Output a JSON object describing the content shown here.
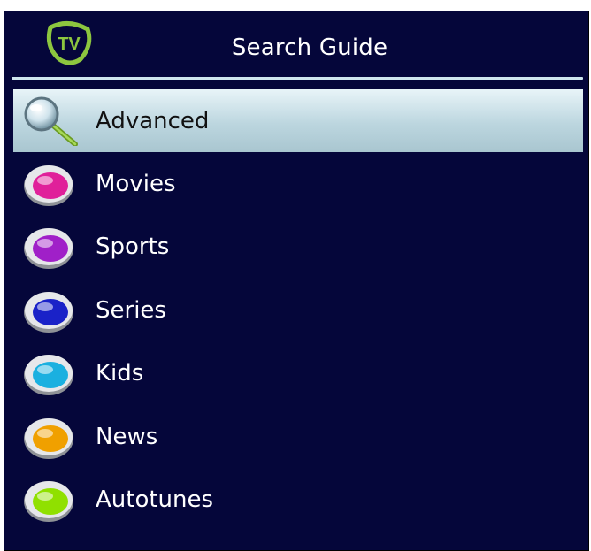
{
  "header": {
    "title": "Search Guide",
    "logo_text": "TV",
    "logo_icon": "tv-logo-icon"
  },
  "menu": {
    "items": [
      {
        "label": "Advanced",
        "icon": "magnifier-icon",
        "selected": true
      },
      {
        "label": "Movies",
        "icon": "colored-button-icon",
        "color": "#e0209a"
      },
      {
        "label": "Sports",
        "icon": "colored-button-icon",
        "color": "#a020c8"
      },
      {
        "label": "Series",
        "icon": "colored-button-icon",
        "color": "#1a22c8"
      },
      {
        "label": "Kids",
        "icon": "colored-button-icon",
        "color": "#1ab0e0"
      },
      {
        "label": "News",
        "icon": "colored-button-icon",
        "color": "#f0a000"
      },
      {
        "label": "Autotunes",
        "icon": "colored-button-icon",
        "color": "#90e000"
      }
    ]
  },
  "colors": {
    "background": "#05063a",
    "selected_highlight": "#bcd6df",
    "header_rule": "#cfe6ee",
    "logo_green": "#8dc63f"
  }
}
